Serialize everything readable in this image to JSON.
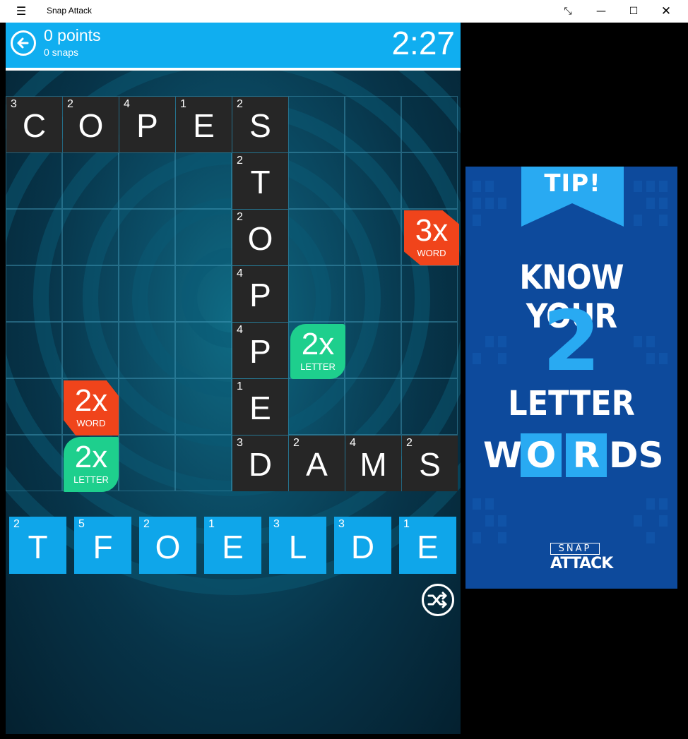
{
  "window": {
    "title": "Snap Attack",
    "menu_icon": "hamburger-icon",
    "controls": [
      "expand-icon",
      "minimize-icon",
      "maximize-icon",
      "close-icon"
    ]
  },
  "header": {
    "points": "0 points",
    "snaps": "0 snaps",
    "timer": "2:27"
  },
  "board": {
    "tiles": [
      {
        "letter": "C",
        "points": "3"
      },
      {
        "letter": "O",
        "points": "2"
      },
      {
        "letter": "P",
        "points": "4"
      },
      {
        "letter": "E",
        "points": "1"
      },
      {
        "letter": "S",
        "points": "2"
      },
      {
        "letter": "T",
        "points": "2"
      },
      {
        "letter": "O",
        "points": "2"
      },
      {
        "letter": "P",
        "points": "4"
      },
      {
        "letter": "P",
        "points": "4"
      },
      {
        "letter": "E",
        "points": "1"
      },
      {
        "letter": "D",
        "points": "3"
      },
      {
        "letter": "A",
        "points": "2"
      },
      {
        "letter": "M",
        "points": "4"
      },
      {
        "letter": "S",
        "points": "2"
      }
    ],
    "bonuses": [
      {
        "big": "3x",
        "small": "WORD"
      },
      {
        "big": "2x",
        "small": "LETTER"
      },
      {
        "big": "2x",
        "small": "WORD"
      },
      {
        "big": "2x",
        "small": "LETTER"
      }
    ]
  },
  "rack": [
    {
      "letter": "T",
      "points": "2"
    },
    {
      "letter": "F",
      "points": "5"
    },
    {
      "letter": "O",
      "points": "2"
    },
    {
      "letter": "E",
      "points": "1"
    },
    {
      "letter": "L",
      "points": "3"
    },
    {
      "letter": "D",
      "points": "3"
    },
    {
      "letter": "E",
      "points": "1"
    }
  ],
  "ad": {
    "tip": "TIP!",
    "line1": "KNOW YOUR",
    "number": "2",
    "line2": "LETTER",
    "word_letters": [
      "W",
      "O",
      "R",
      "DS"
    ],
    "logo_top": "SNAP",
    "logo_bottom": "ATTACK"
  },
  "colors": {
    "header": "#10aef0",
    "rack_tile": "#0fa6ea",
    "word_bonus": "#f0441b",
    "letter_bonus": "#1ecf8d",
    "board_tile": "#262626",
    "ad_background": "#0d4a9c",
    "ad_accent": "#29aaf2"
  }
}
